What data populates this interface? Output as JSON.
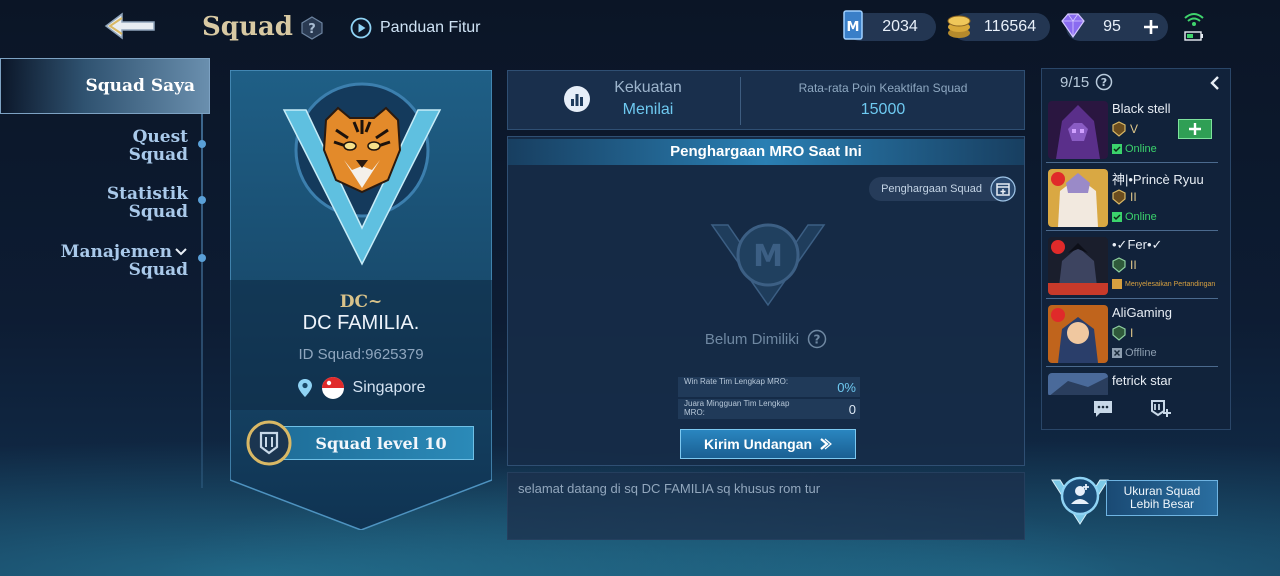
{
  "header": {
    "title": "Squad",
    "guide_label": "Panduan Fitur"
  },
  "currencies": [
    {
      "icon": "mro-point-icon",
      "value": "2034"
    },
    {
      "icon": "battle-points-icon",
      "value": "116564"
    },
    {
      "icon": "diamond-icon",
      "value": "95"
    }
  ],
  "menu": {
    "items": [
      {
        "label": "Squad Saya"
      },
      {
        "label_line1": "Quest",
        "label_line2": "Squad"
      },
      {
        "label_line1": "Statistik",
        "label_line2": "Squad"
      },
      {
        "label_line1": "Manajemen",
        "label_line2": "Squad"
      }
    ]
  },
  "squad": {
    "tag": "DC~",
    "name": "DC FAMILIA.",
    "id_text": "ID Squad:9625379",
    "location": "Singapore",
    "level_label": "Squad level 10"
  },
  "stats": {
    "power_label": "Kekuatan",
    "power_value": "Menilai",
    "avg_label": "Rata-rata Poin Keaktifan Squad",
    "avg_value": "15000"
  },
  "mro": {
    "header": "Penghargaan MRO Saat Ini",
    "award_link": "Penghargaan Squad",
    "not_owned": "Belum Dimiliki",
    "rows": [
      {
        "label": "Win Rate Tim Lengkap MRO:",
        "value": "0%"
      },
      {
        "label": "Juara Mingguan Tim Lengkap MRO:",
        "value": "0"
      }
    ],
    "invite_label": "Kirim Undangan"
  },
  "announcement": "selamat datang di sq DC FAMILIA sq khusus rom tur",
  "members": {
    "count": "9/15",
    "list": [
      {
        "name": "Black stell",
        "rank": "V",
        "status": "Online",
        "status_type": "online"
      },
      {
        "name": "神|•Princè Ryuu",
        "rank": "II",
        "status": "Online",
        "status_type": "online"
      },
      {
        "name": "•✓Fer•✓",
        "rank": "II",
        "status": "Menyelesaikan Pertandingan",
        "status_type": "match"
      },
      {
        "name": "AliGaming",
        "rank": "I",
        "status": "Offline",
        "status_type": "offline"
      },
      {
        "name": "fetrick star",
        "rank": "",
        "status": "",
        "status_type": ""
      }
    ]
  },
  "bigger_squad": {
    "line1": "Ukuran Squad",
    "line2": "Lebih Besar"
  },
  "colors": {
    "accent": "#6ec9f0",
    "online": "#3bd36c",
    "gold": "#d9c38a",
    "add_green": "#2f9f55"
  }
}
